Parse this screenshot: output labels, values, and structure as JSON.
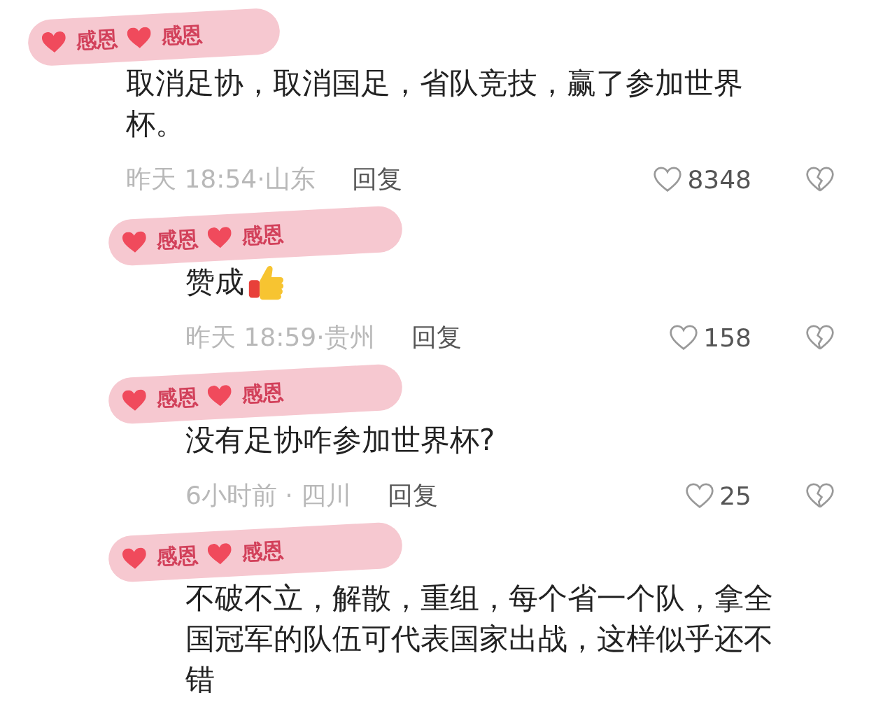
{
  "comment": {
    "stamps": [
      "感恩",
      "感恩"
    ],
    "text": "取消足协，取消国足，省队竞技，赢了参加世界杯。",
    "thumbs": false,
    "time": "昨天 18:54·山东",
    "reply": "回复",
    "likes": "8348",
    "children": [
      {
        "stamps": [
          "感恩",
          "感恩"
        ],
        "text": "赞成",
        "thumbs": true,
        "time": "昨天 18:59·贵州",
        "reply": "回复",
        "likes": "158"
      },
      {
        "stamps": [
          "感恩",
          "感恩"
        ],
        "text": "没有足协咋参加世界杯?",
        "thumbs": false,
        "time": "6小时前 · 四川",
        "reply": "回复",
        "likes": "25"
      },
      {
        "stamps": [
          "感恩",
          "感恩"
        ],
        "text": "不破不立，解散，重组，每个省一个队，拿全国冠军的队伍可代表国家出战，这样似乎还不错",
        "thumbs": false
      }
    ]
  }
}
